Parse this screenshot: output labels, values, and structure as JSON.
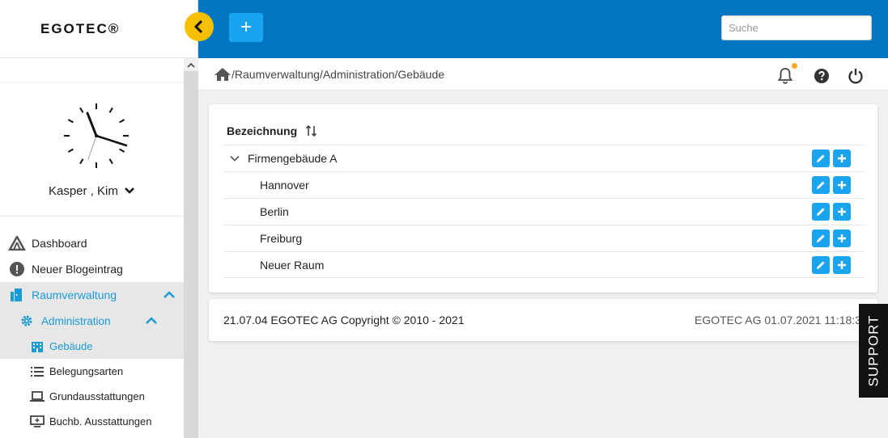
{
  "brand": {
    "logo_text": "EGOTEC®"
  },
  "header": {
    "add_label": "+",
    "search_placeholder": "Suche"
  },
  "user": {
    "name": "Kasper , Kim"
  },
  "breadcrumb": {
    "path": "/Raumverwaltung/Administration/Gebäude"
  },
  "nav": {
    "dashboard": "Dashboard",
    "blog": "Neuer Blogeintrag",
    "raumverwaltung": "Raumverwaltung",
    "administration": "Administration",
    "gebaeude": "Gebäude",
    "belegungsarten": "Belegungsarten",
    "grundausstattungen": "Grundausstattungen",
    "buchb": "Buchb. Ausstattungen"
  },
  "table": {
    "column": "Bezeichnung",
    "rows": [
      {
        "label": "Firmengebäude A",
        "level": 0,
        "expanded": true
      },
      {
        "label": "Hannover",
        "level": 1
      },
      {
        "label": "Berlin",
        "level": 1
      },
      {
        "label": "Freiburg",
        "level": 1
      },
      {
        "label": "Neuer Raum",
        "level": 1
      }
    ]
  },
  "footer": {
    "left": "21.07.04 EGOTEC AG Copyright © 2010 - 2021",
    "right": "EGOTEC AG  01.07.2021 11:18:3"
  },
  "support": {
    "label": "SUPPORT"
  },
  "colors": {
    "primary": "#0076c3",
    "accent": "#1aa3ef",
    "toggle": "#f5c000",
    "active_text": "#1a9ad6"
  }
}
